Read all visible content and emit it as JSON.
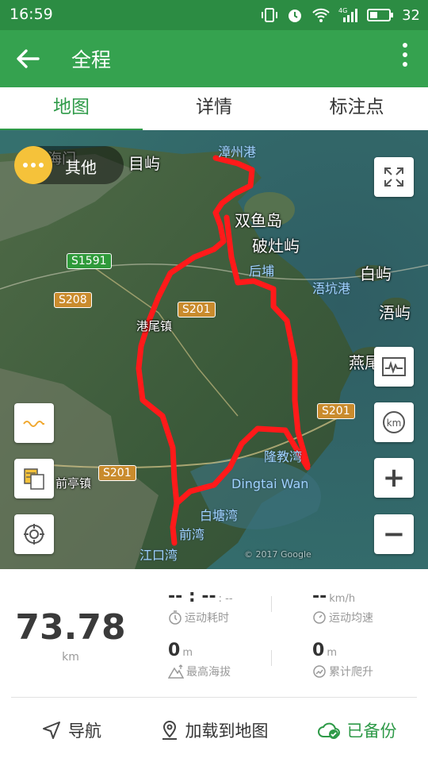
{
  "status_bar": {
    "time": "16:59",
    "battery": "32",
    "network": "4G"
  },
  "toolbar": {
    "title": "全程"
  },
  "tabs": [
    {
      "label": "地图"
    },
    {
      "label": "详情"
    },
    {
      "label": "标注点"
    }
  ],
  "map": {
    "other_chip_label": "其他",
    "places": {
      "zhangzhougang": "漳州港",
      "muyu": "目屿",
      "haimen": "海门",
      "shuangyudao": "双鱼岛",
      "pozaoyu": "破灶屿",
      "baiyu": "白屿",
      "jiuyu": "浯屿",
      "yanwei": "燕尾",
      "houkenggang": "浯坑港",
      "gangweizhen": "港尾镇",
      "qiantingzhen": "前亭镇",
      "longjiaowan": "隆教湾",
      "dingtai": "Dingtai Wan",
      "baitangwan": "白塘湾",
      "qianwan": "前湾",
      "jiangkouwan": "江口湾",
      "xiaowu": "后埔"
    },
    "road_signs": {
      "s1591": "S1591",
      "s208": "S208",
      "s201a": "S201",
      "s201b": "S201",
      "s201c": "S201"
    },
    "watermark": "© 2017 Google",
    "controls": {
      "fullscreen_icon": "expand-icon",
      "chart_icon": "waveform-icon",
      "unit_label": "km",
      "zoom_in": "+",
      "zoom_out": "−"
    }
  },
  "stats": {
    "distance": {
      "value": "73.78",
      "unit": "km"
    },
    "duration": {
      "value": "-- : --",
      "sub": ": --",
      "label": "运动耗时"
    },
    "avg_speed": {
      "value": "--",
      "unit": "km/h",
      "label": "运动均速"
    },
    "max_altitude": {
      "value": "0",
      "unit": "m",
      "label": "最高海拔"
    },
    "climb": {
      "value": "0",
      "unit": "m",
      "label": "累计爬升"
    }
  },
  "actions": {
    "navigate": "导航",
    "load_to_map": "加载到地图",
    "backed_up": "已备份"
  },
  "colors": {
    "brand": "#35a24f",
    "route": "#ff1a1a",
    "accent_yellow": "#f5c23a"
  }
}
